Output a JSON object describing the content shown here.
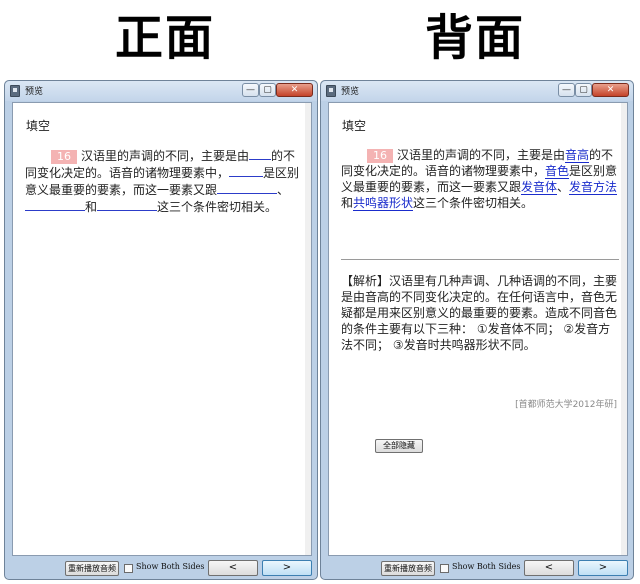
{
  "labels": {
    "front": "正面",
    "back": "背面"
  },
  "window": {
    "title": "预览",
    "min": "—",
    "max": "▢",
    "close": "✕"
  },
  "question": {
    "type": "填空",
    "number": "16",
    "seg1": "汉语里的声调的不同，主要是由",
    "seg2": "的不同变化决定的。语音的诸物理要素中，",
    "seg3": "是区别意义最重要的要素，而这一要素又跟",
    "sep1": "、",
    "seg4": "和",
    "seg5": "这三个条件密切相关。"
  },
  "answers": [
    "音高",
    "音色",
    "发音体",
    "发音方法",
    "共鸣器形状"
  ],
  "analysis": {
    "text": "【解析】汉语里有几种声调、几种语调的不同，主要是由音高的不同变化决定的。在任何语言中，音色无疑都是用来区别意义的最重要的要素。造成不同音色的条件主要有以下三种： ①发音体不同； ②发音方法不同； ③发音时共鸣器形状不同。",
    "source": "[首都师范大学2012年研]",
    "hide_button": "全部隐藏"
  },
  "bottom": {
    "replay": "重新播放音频",
    "show_both": "Show Both Sides",
    "prev": "<",
    "next": ">"
  }
}
